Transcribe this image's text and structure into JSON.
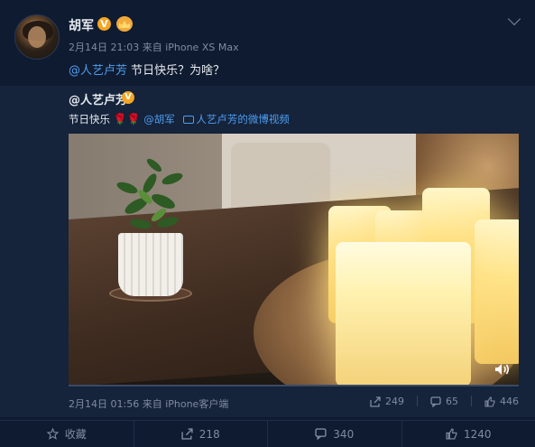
{
  "post": {
    "username": "胡军",
    "verified_label": "V",
    "timestamp": "2月14日 21:03",
    "source": "来自 iPhone XS Max",
    "mention": "@人艺卢芳",
    "text": " 节日快乐？为啥？"
  },
  "repost": {
    "username": "@人艺卢芳",
    "verified_label": "V",
    "text_prefix": "节日快乐",
    "mention": "@胡军",
    "video_link": "人艺卢芳的微博视频",
    "timestamp": "2月14日 01:56",
    "source": "来自 iPhone客户端",
    "reposts": "249",
    "comments": "65",
    "likes": "446",
    "video_progress": 0
  },
  "bottom_bar": {
    "favorite_label": "收藏",
    "repost_count": "218",
    "comment_count": "340",
    "like_count": "1240"
  },
  "colors": {
    "accent_link": "#4e9ef0",
    "badge": "#f5a623"
  }
}
